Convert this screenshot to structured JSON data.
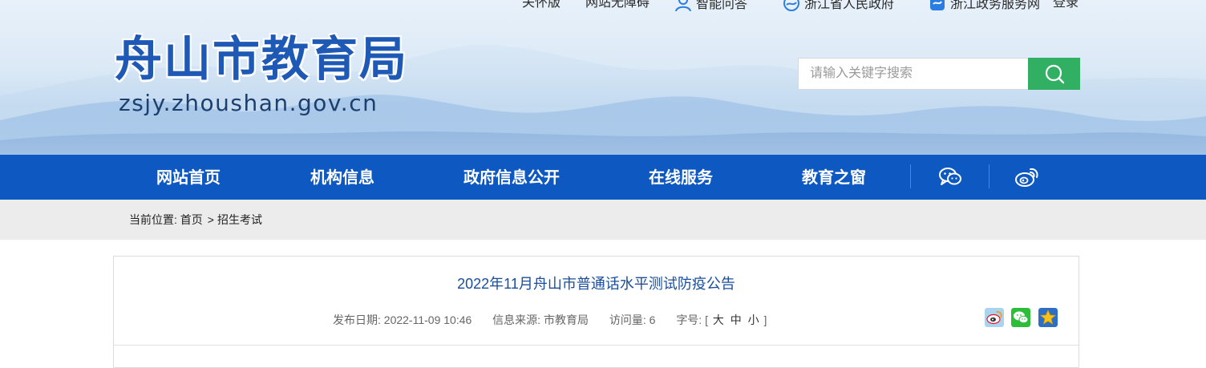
{
  "top_links": {
    "elder_version": "关怀版",
    "accessibility": "网站无障碍",
    "smart_qa": "智能问答",
    "zj_gov": "浙江省人民政府",
    "zj_service": "浙江政务服务网",
    "login": "登录"
  },
  "logo": {
    "cn": "舟山市教育局",
    "en": "zsjy.zhoushan.gov.cn"
  },
  "search": {
    "placeholder": "请输入关键字搜索"
  },
  "nav": {
    "items": [
      "网站首页",
      "机构信息",
      "政府信息公开",
      "在线服务",
      "教育之窗"
    ]
  },
  "breadcrumb": {
    "prefix": "当前位置:",
    "home": "首页",
    "separator": ">",
    "current": "招生考试"
  },
  "article": {
    "title": "2022年11月舟山市普通话水平测试防疫公告",
    "publish_date": "发布日期: 2022-11-09 10:46",
    "source": "信息来源: 市教育局",
    "views": "访问量: 6",
    "font_size_label": "字号: [",
    "font_large": "大",
    "font_medium": "中",
    "font_small": "小",
    "font_size_end": "]"
  },
  "colors": {
    "nav_bg": "#0e58c2",
    "search_btn": "#31b064",
    "logo": "#1d59b5",
    "title": "#1a4e9a"
  }
}
